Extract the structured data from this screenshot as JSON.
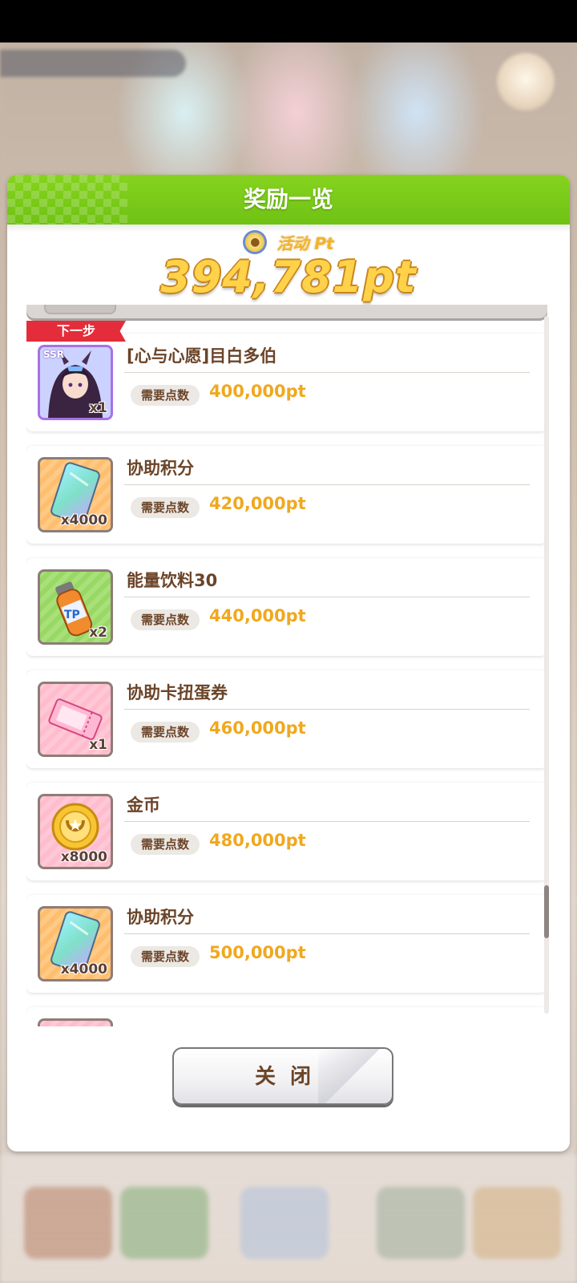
{
  "modal": {
    "title": "奖励一览",
    "pt_label": "活动 Pt",
    "pt_value": "394,781pt",
    "close_label": "关闭"
  },
  "list": {
    "next_step_label": "下一步",
    "req_label": "需要点数",
    "items": [
      {
        "name": "[心与心愿]目白多伯",
        "qty": "x1",
        "required": "400,000pt",
        "icon": "ssr-card-icon",
        "rarity": "SSR"
      },
      {
        "name": "协助积分",
        "qty": "x4000",
        "required": "420,000pt",
        "icon": "support-point-ticket-icon"
      },
      {
        "name": "能量饮料30",
        "qty": "x2",
        "required": "440,000pt",
        "icon": "energy-drink-icon",
        "label": "TP"
      },
      {
        "name": "协助卡扭蛋券",
        "qty": "x1",
        "required": "460,000pt",
        "icon": "gacha-ticket-icon"
      },
      {
        "name": "金币",
        "qty": "x8000",
        "required": "480,000pt",
        "icon": "gold-coin-icon"
      },
      {
        "name": "协助积分",
        "qty": "x4000",
        "required": "500,000pt",
        "icon": "support-point-ticket-icon"
      }
    ]
  },
  "colors": {
    "header_green": "#7ccb1a",
    "pt_gold": "#ffd24a",
    "required_orange": "#f0a81e",
    "ribbon_red": "#e52c3a",
    "text_brown": "#6b4428"
  }
}
